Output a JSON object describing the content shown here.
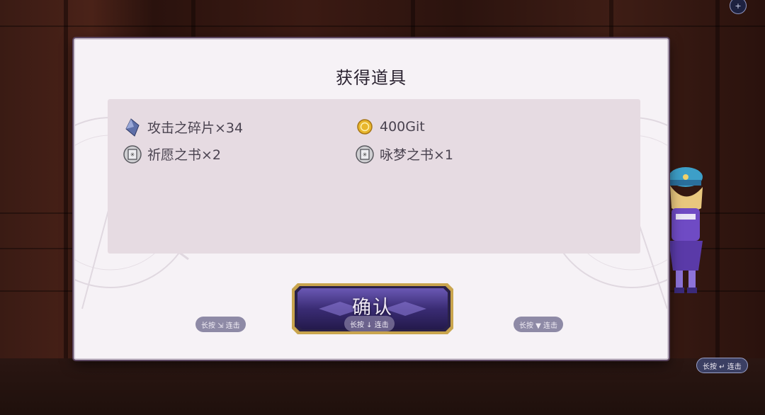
{
  "dialog": {
    "title": "获得道具",
    "items": [
      {
        "name": "攻击之碎片×34",
        "icon": "crystal-shard-icon"
      },
      {
        "name": "400Git",
        "icon": "gold-coin-icon"
      },
      {
        "name": "祈愿之书×2",
        "icon": "book-icon"
      },
      {
        "name": "咏梦之书×1",
        "icon": "book-icon"
      }
    ],
    "confirm_label": "确认",
    "confirm_hint": "长按 ↓ 连击"
  },
  "hints": {
    "left": "长按 ⇲ 连击",
    "right": "长按 ▼ 连击",
    "outer": "长按 ↵ 连击"
  },
  "corner_button": "+",
  "colors": {
    "panel_bg": "#f6f2f6",
    "items_bg": "#e6dbe2",
    "button_frame": "#c9a54e",
    "button_body": "#4a3a86",
    "hint_bg": "#8e8aa6"
  }
}
